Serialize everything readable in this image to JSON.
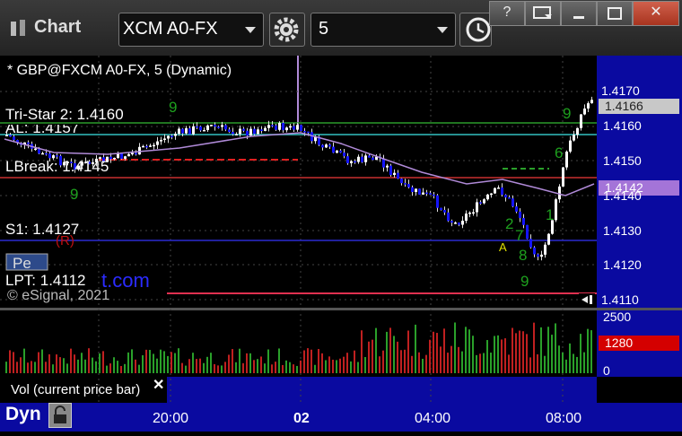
{
  "window": {
    "title": "Chart",
    "symbol": "XCM A0-FX",
    "interval": "5",
    "btn_help": "?",
    "btn_close": "✕"
  },
  "chart": {
    "header": "* GBP@FXCM A0-FX, 5 (Dynamic)",
    "labels": {
      "tristar": "Tri-Star 2: 1.4160",
      "al": "AL: 1.4157",
      "lbreak": "LBreak: 1.4145",
      "s1": "S1: 1.4127",
      "lpt": "LPT: 1.4112",
      "pe": "Pe",
      "watermark_link": "t.com",
      "copyright": "© eSignal, 2021"
    },
    "price_axis": [
      "1.4170",
      "1.4160",
      "1.4150",
      "1.4140",
      "1.4130",
      "1.4120",
      "1.4110"
    ],
    "last_price": "1.4166",
    "ma_price": "1.4142",
    "volume_axis": [
      "2500",
      "0"
    ],
    "last_volume": "1280",
    "volume_study": "Vol (current price bar)",
    "time_axis": [
      "20:00",
      "02",
      "04:00",
      "08:00"
    ],
    "footer_mode": "Dyn",
    "colors": {
      "up_candle": "#ffffff",
      "down_candle": "#1414ff",
      "ma_line": "#b08ad8",
      "axis_bg": "#0a0aa0",
      "last_tag": "#c8c8c8",
      "ma_tag": "#a474d8",
      "vol_tag": "#d40000"
    }
  }
}
